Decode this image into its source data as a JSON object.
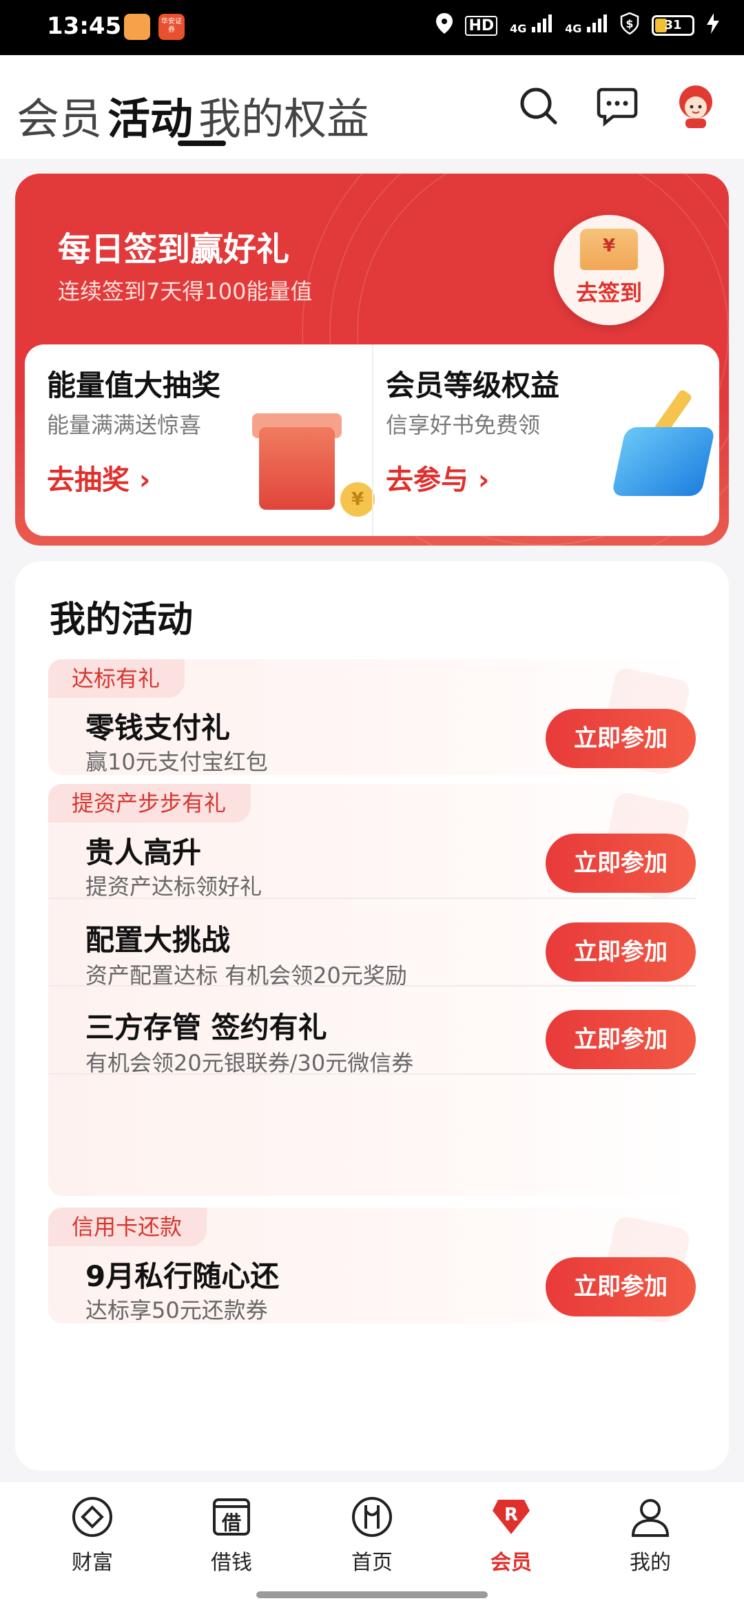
{
  "status_bar": {
    "time": "13:45",
    "network1": "4G",
    "network2": "4G",
    "hd": "HD",
    "battery": "31",
    "app_badge": "华安证券"
  },
  "header": {
    "tabs": [
      "会员",
      "活动",
      "我的权益"
    ],
    "active_tab": "活动"
  },
  "hero": {
    "title": "每日签到赢好礼",
    "subtitle": "连续签到7天得100能量值",
    "signin_button": "去签到",
    "envelope_symbol": "¥",
    "left_card": {
      "title": "能量值大抽奖",
      "subtitle": "能量满满送惊喜",
      "link": "去抽奖 ›"
    },
    "right_card": {
      "title": "会员等级权益",
      "subtitle": "信享好书免费领",
      "link": "去参与 ›"
    },
    "coin_symbol": "¥"
  },
  "activities": {
    "title": "我的活动",
    "groups": [
      {
        "tag": "达标有礼",
        "items": [
          {
            "title": "零钱支付礼",
            "subtitle": "赢10元支付宝红包",
            "button": "立即参加"
          }
        ]
      },
      {
        "tag": "提资产步步有礼",
        "items": [
          {
            "title": "贵人高升",
            "subtitle": "提资产达标领好礼",
            "button": "立即参加"
          },
          {
            "title": "配置大挑战",
            "subtitle": "资产配置达标 有机会领20元奖励",
            "button": "立即参加"
          },
          {
            "title": "三方存管 签约有礼",
            "subtitle": "有机会领20元银联券/30元微信券",
            "button": "立即参加"
          }
        ]
      },
      {
        "tag": "信用卡还款",
        "items": [
          {
            "title": "9月私行随心还",
            "subtitle": "达标享50元还款券",
            "button": "立即参加"
          }
        ]
      }
    ]
  },
  "bottom_nav": {
    "items": [
      "财富",
      "借钱",
      "首页",
      "会员",
      "我的"
    ],
    "active": "会员",
    "borrow_glyph": "借"
  },
  "colors": {
    "accent": "#e0302c",
    "hero_bg": "#e2393a",
    "button": "#eb3f3c"
  }
}
